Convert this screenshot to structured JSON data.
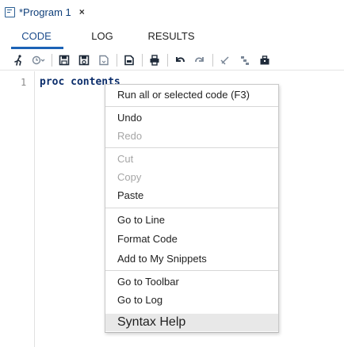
{
  "document_tab": {
    "title": "*Program 1",
    "close": "×"
  },
  "view_tabs": [
    {
      "label": "CODE",
      "active": true
    },
    {
      "label": "LOG",
      "active": false
    },
    {
      "label": "RESULTS",
      "active": false
    }
  ],
  "toolbar": {
    "icons": [
      "run-icon",
      "history-icon",
      "save-icon",
      "save-as-icon",
      "download-icon",
      "export-icon",
      "print-icon",
      "undo-icon",
      "redo-icon",
      "clear-icon",
      "format-icon",
      "snippets-icon"
    ]
  },
  "editor": {
    "lines": [
      {
        "number": "1",
        "text": "proc contents"
      }
    ]
  },
  "context_menu": {
    "items": [
      {
        "label": "Run all or selected code (F3)",
        "disabled": false
      },
      {
        "label": "Undo",
        "disabled": false
      },
      {
        "label": "Redo",
        "disabled": true
      },
      {
        "label": "Cut",
        "disabled": true
      },
      {
        "label": "Copy",
        "disabled": true
      },
      {
        "label": "Paste",
        "disabled": false
      },
      {
        "label": "Go to Line",
        "disabled": false
      },
      {
        "label": "Format Code",
        "disabled": false
      },
      {
        "label": "Add to My Snippets",
        "disabled": false
      },
      {
        "label": "Go to Toolbar",
        "disabled": false
      },
      {
        "label": "Go to Log",
        "disabled": false
      },
      {
        "label": "Syntax Help",
        "disabled": false,
        "highlighted": true
      }
    ]
  },
  "colors": {
    "accent": "#1c63b6",
    "tab_text_active": "#1c4c8c",
    "code_text": "#0b2d6b",
    "disabled_text": "#a6a6a6"
  }
}
